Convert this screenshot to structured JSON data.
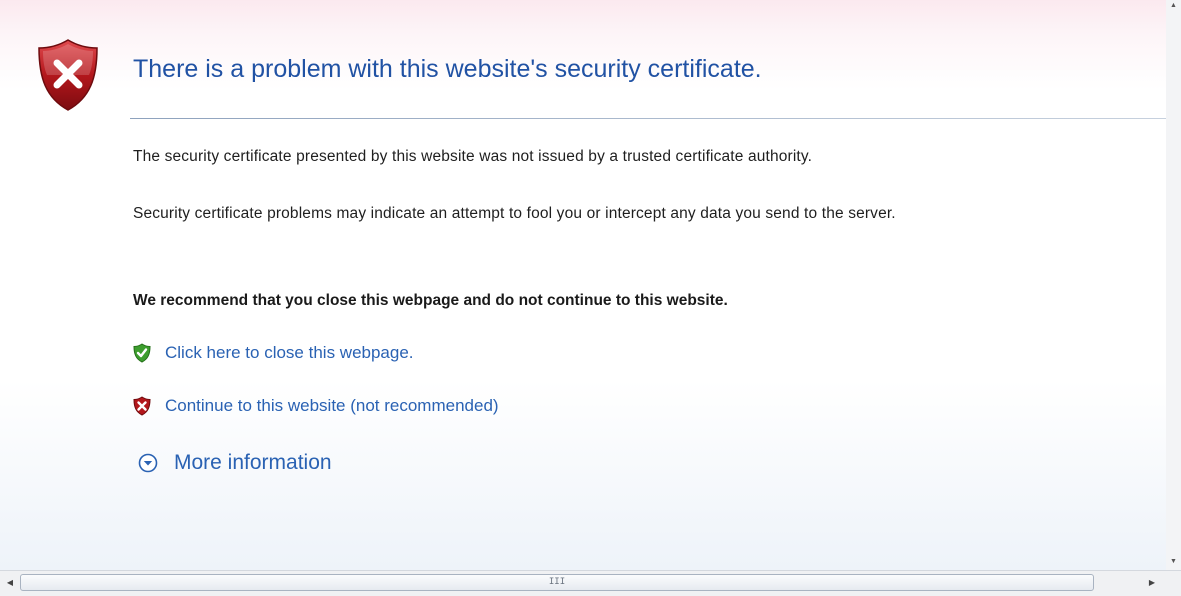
{
  "header": {
    "icon": "shield-error-icon",
    "title": "There is a problem with this website's security certificate."
  },
  "body": {
    "paragraph1": "The security certificate presented by this website was not issued by a trusted certificate authority.",
    "paragraph2": "Security certificate problems may indicate an attempt to fool you or intercept any data you send to the server.",
    "recommendation": "We recommend that you close this webpage and do not continue to this website."
  },
  "links": {
    "close": {
      "label": "Click here to close this webpage.",
      "icon": "shield-check-icon"
    },
    "continue": {
      "label": "Continue to this website (not recommended)",
      "icon": "shield-x-icon"
    },
    "more": {
      "label": "More information",
      "icon": "expand-circle-icon"
    }
  },
  "colors": {
    "link": "#2a62b3",
    "title": "#2152a4",
    "shield_red": "#b3171c",
    "shield_green": "#3d9e2e"
  },
  "scrollbar": {
    "grip": "III"
  }
}
